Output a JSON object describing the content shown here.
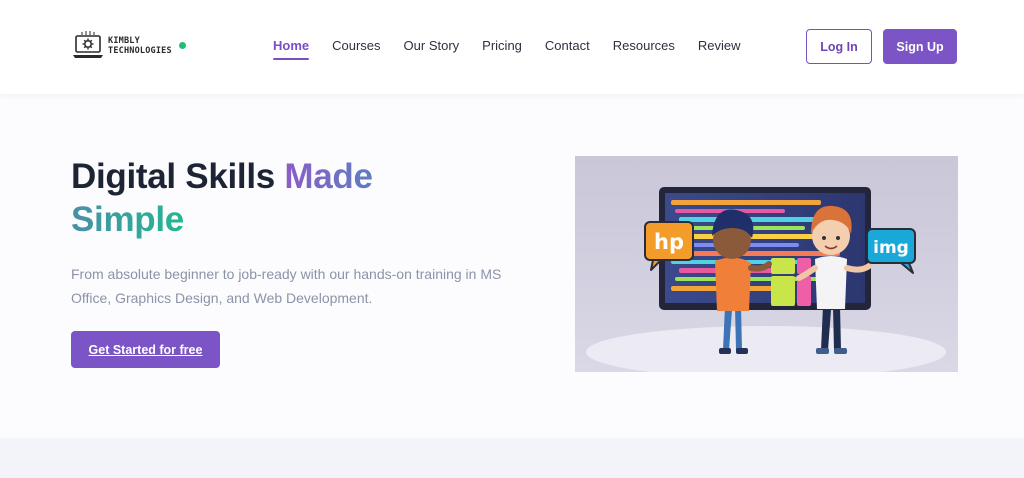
{
  "brand": {
    "line1": "KIMBLY",
    "line2": "TECHNOLOGIES",
    "status_color": "#1fbf7a",
    "accent_color": "#7b55c6"
  },
  "nav": {
    "items": [
      {
        "label": "Home",
        "active": true
      },
      {
        "label": "Courses",
        "active": false
      },
      {
        "label": "Our Story",
        "active": false
      },
      {
        "label": "Pricing",
        "active": false
      },
      {
        "label": "Contact",
        "active": false
      },
      {
        "label": "Resources",
        "active": false
      },
      {
        "label": "Review",
        "active": false
      }
    ]
  },
  "auth": {
    "login_label": "Log In",
    "signup_label": "Sign Up"
  },
  "hero": {
    "title_part1": "Digital Skills ",
    "title_highlight1": "Made",
    "title_highlight2": "Simple",
    "subtitle": "From absolute beginner to job-ready with our hands-on training in MS Office, Graphics Design, and Web Development.",
    "cta_label": "Get Started for free",
    "illustration": {
      "bubble_left": "hp",
      "bubble_right": "img",
      "bubble_left_color": "#f39c2a",
      "bubble_right_color": "#1aa8d8"
    }
  }
}
